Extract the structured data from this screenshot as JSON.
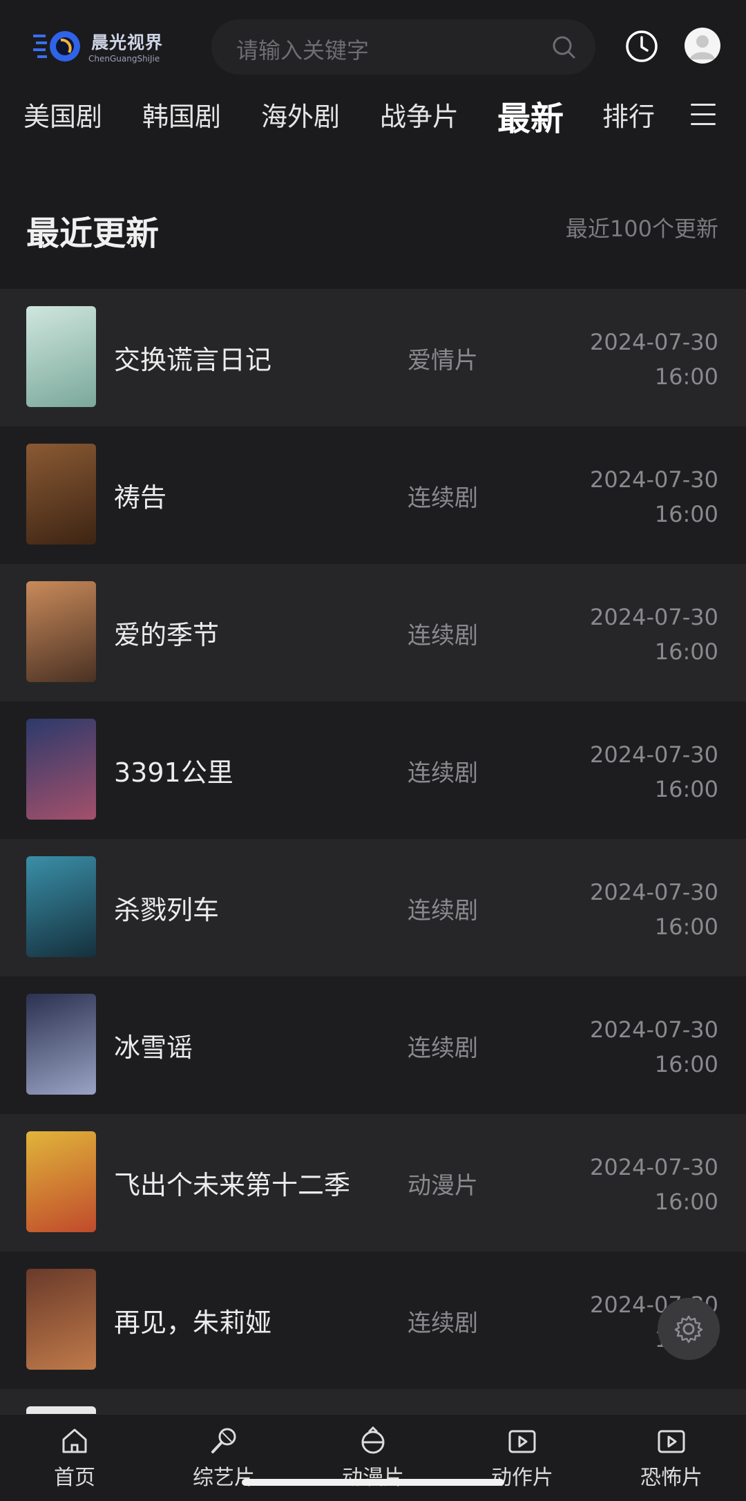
{
  "header": {
    "logo_text": "晨光视界",
    "logo_sub": "ChenGuangShiJie",
    "search_placeholder": "请输入关键字"
  },
  "categories": [
    {
      "label": "美国剧",
      "active": false
    },
    {
      "label": "韩国剧",
      "active": false
    },
    {
      "label": "海外剧",
      "active": false
    },
    {
      "label": "战争片",
      "active": false
    },
    {
      "label": "最新",
      "active": true
    },
    {
      "label": "排行",
      "active": false
    }
  ],
  "section": {
    "title": "最近更新",
    "note": "最近100个更新"
  },
  "items": [
    {
      "title": "交换谎言日记",
      "genre": "爱情片",
      "date": "2024-07-30",
      "time": "16:00",
      "poster_colors": [
        "#cfe6de",
        "#7aa89a"
      ]
    },
    {
      "title": "祷告",
      "genre": "连续剧",
      "date": "2024-07-30",
      "time": "16:00",
      "poster_colors": [
        "#8a5a34",
        "#3d2413"
      ]
    },
    {
      "title": "爱的季节",
      "genre": "连续剧",
      "date": "2024-07-30",
      "time": "16:00",
      "poster_colors": [
        "#c98a5a",
        "#4a3124"
      ]
    },
    {
      "title": "3391公里",
      "genre": "连续剧",
      "date": "2024-07-30",
      "time": "16:00",
      "poster_colors": [
        "#2c3a6b",
        "#a4506b"
      ]
    },
    {
      "title": "杀戮列车",
      "genre": "连续剧",
      "date": "2024-07-30",
      "time": "16:00",
      "poster_colors": [
        "#3a8fa8",
        "#15303d"
      ]
    },
    {
      "title": "冰雪谣",
      "genre": "连续剧",
      "date": "2024-07-30",
      "time": "16:00",
      "poster_colors": [
        "#2b3150",
        "#9aa3c4"
      ]
    },
    {
      "title": "飞出个未来第十二季",
      "genre": "动漫片",
      "date": "2024-07-30",
      "time": "16:00",
      "poster_colors": [
        "#e0b53a",
        "#c04a2c"
      ]
    },
    {
      "title": "再见，朱莉娅",
      "genre": "连续剧",
      "date": "2024-07-30",
      "time": "16:00",
      "poster_colors": [
        "#6a3a2a",
        "#c07a4a"
      ]
    }
  ],
  "tabs": [
    {
      "label": "首页",
      "icon": "home-icon"
    },
    {
      "label": "综艺片",
      "icon": "microphone-icon"
    },
    {
      "label": "动漫片",
      "icon": "anime-icon"
    },
    {
      "label": "动作片",
      "icon": "video-icon"
    },
    {
      "label": "恐怖片",
      "icon": "video-icon"
    }
  ],
  "colors": {
    "background": "#1b1b1d",
    "row_alt": "#262628",
    "accent": "#3a5fd8"
  }
}
